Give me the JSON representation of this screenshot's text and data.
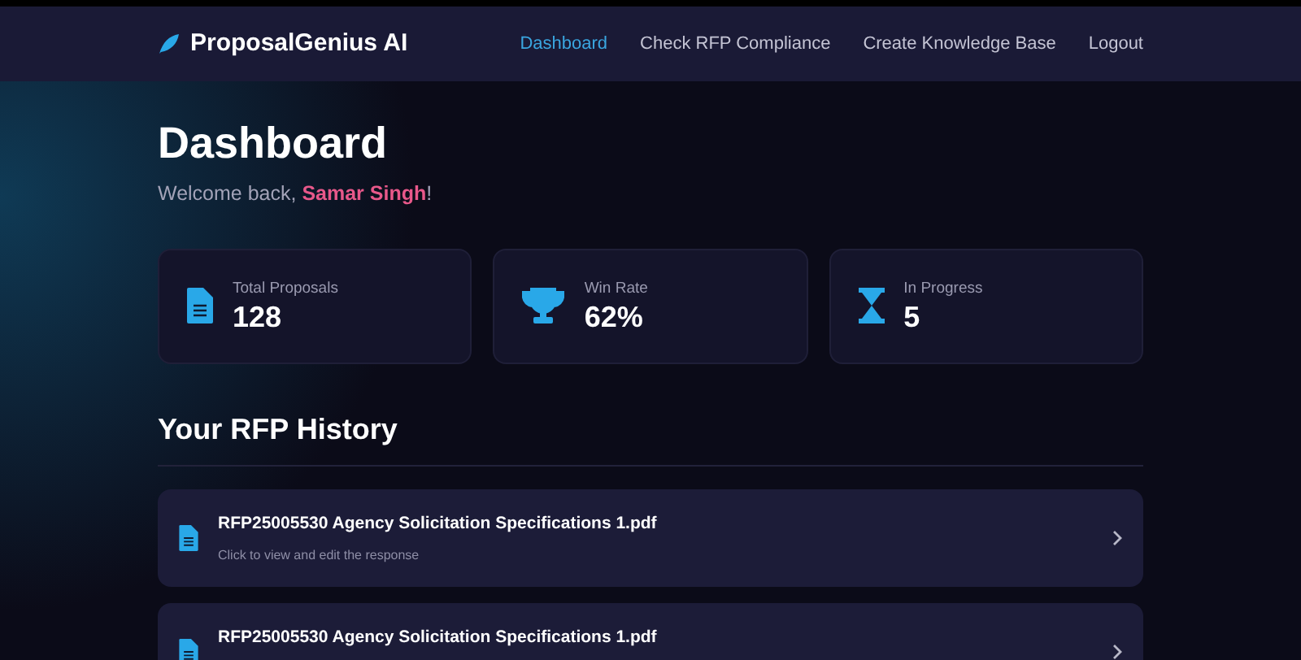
{
  "brand": {
    "name": "ProposalGenius AI"
  },
  "nav": [
    {
      "label": "Dashboard",
      "selected": true
    },
    {
      "label": "Check RFP Compliance",
      "selected": false
    },
    {
      "label": "Create Knowledge Base",
      "selected": false
    },
    {
      "label": "Logout",
      "selected": false
    }
  ],
  "page": {
    "title": "Dashboard",
    "welcome": "Welcome back, ",
    "user": "Samar Singh",
    "welcome_end": "!"
  },
  "stats": [
    {
      "kind": "document",
      "label": "Total Proposals",
      "value": "128"
    },
    {
      "kind": "trophy",
      "label": "Win Rate",
      "value": "62%"
    },
    {
      "kind": "hourglass",
      "label": "In Progress",
      "value": "5"
    }
  ],
  "history": {
    "title": "Your RFP History",
    "items": [
      {
        "name": "RFP25005530 Agency Solicitation Specifications 1.pdf",
        "hint": "Click to view and edit the response"
      },
      {
        "name": "RFP25005530 Agency Solicitation Specifications 1.pdf"
      }
    ]
  }
}
